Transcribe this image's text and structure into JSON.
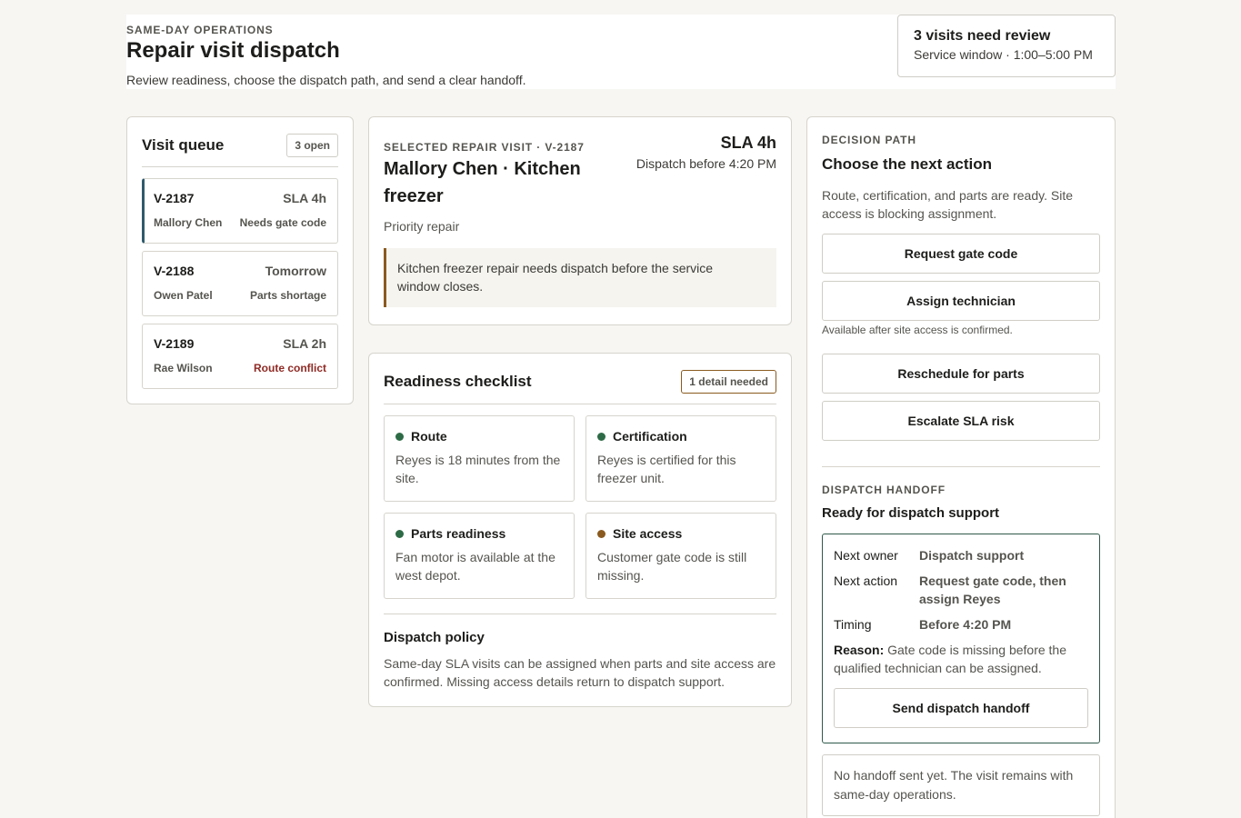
{
  "header": {
    "eyebrow": "SAME-DAY OPERATIONS",
    "title": "Repair visit dispatch",
    "subtitle": "Review readiness, choose the dispatch path, and send a clear handoff.",
    "review": {
      "title": "3 visits need review",
      "subtitle": "Service window · 1:00–5:00 PM"
    }
  },
  "queue": {
    "title": "Visit queue",
    "count": "3 open",
    "visits": [
      {
        "id": "V-2187",
        "meta": "SLA 4h",
        "customer": "Mallory Chen",
        "status": "Needs gate code",
        "alert": false,
        "selected": true
      },
      {
        "id": "V-2188",
        "meta": "Tomorrow",
        "customer": "Owen Patel",
        "status": "Parts shortage",
        "alert": false,
        "selected": false
      },
      {
        "id": "V-2189",
        "meta": "SLA 2h",
        "customer": "Rae Wilson",
        "status": "Route conflict",
        "alert": true,
        "selected": false
      }
    ]
  },
  "selected": {
    "eyebrow": "SELECTED REPAIR VISIT · V-2187",
    "title": "Mallory Chen · Kitchen freezer",
    "priority": "Priority repair",
    "sla": "SLA 4h",
    "deadline": "Dispatch before 4:20 PM",
    "note": "Kitchen freezer repair needs dispatch before the service window closes."
  },
  "checklist": {
    "title": "Readiness checklist",
    "badge": "1 detail needed",
    "items": [
      {
        "name": "Route",
        "desc": "Reyes is 18 minutes from the site.",
        "state": "ok"
      },
      {
        "name": "Certification",
        "desc": "Reyes is certified for this freezer unit.",
        "state": "ok"
      },
      {
        "name": "Parts readiness",
        "desc": "Fan motor is available at the west depot.",
        "state": "ok"
      },
      {
        "name": "Site access",
        "desc": "Customer gate code is still missing.",
        "state": "warn"
      }
    ],
    "policy_title": "Dispatch policy",
    "policy_text": "Same-day SLA visits can be assigned when parts and site access are confirmed. Missing access details return to dispatch support."
  },
  "decision": {
    "eyebrow": "DECISION PATH",
    "title": "Choose the next action",
    "text": "Route, certification, and parts are ready. Site access is blocking assignment.",
    "buttons": {
      "request_gate": "Request gate code",
      "assign": "Assign technician",
      "assign_hint": "Available after site access is confirmed.",
      "reschedule": "Reschedule for parts",
      "escalate": "Escalate SLA risk"
    },
    "handoff": {
      "eyebrow": "DISPATCH HANDOFF",
      "title": "Ready for dispatch support",
      "owner_label": "Next owner",
      "owner": "Dispatch support",
      "action_label": "Next action",
      "action": "Request gate code, then assign Reyes",
      "timing_label": "Timing",
      "timing": "Before 4:20 PM",
      "reason_label": "Reason:",
      "reason": "Gate code is missing before the qualified technician can be assigned.",
      "send": "Send dispatch handoff",
      "status": "No handoff sent yet. The visit remains with same-day operations."
    }
  },
  "colors": {
    "accent": "#2f5a6b",
    "ok": "#2d6b46",
    "warn": "#8a5a1f",
    "alert": "#8f2a24"
  }
}
